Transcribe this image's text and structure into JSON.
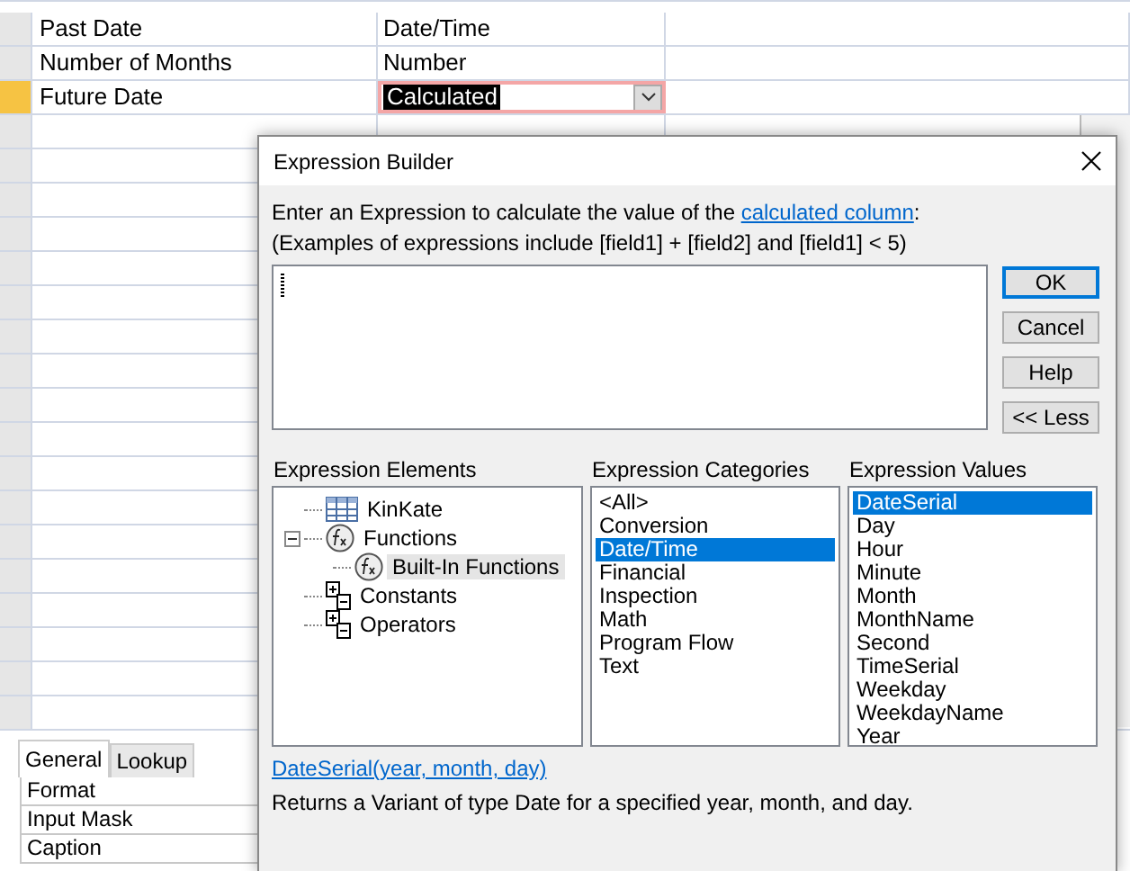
{
  "table": {
    "rows": [
      {
        "field_name": "Past Date",
        "data_type": "Date/Time",
        "selected": false
      },
      {
        "field_name": "Number of Months",
        "data_type": "Number",
        "selected": false
      },
      {
        "field_name": "Future Date",
        "data_type": "Calculated",
        "selected": true
      }
    ]
  },
  "field_properties": {
    "tabs": [
      {
        "label": "General",
        "selected": true
      },
      {
        "label": "Lookup",
        "selected": false
      }
    ],
    "rows": [
      "Format",
      "Input Mask",
      "Caption"
    ]
  },
  "dialog": {
    "title": "Expression Builder",
    "prompt": {
      "text": "Enter an Expression to calculate the value of the",
      "link": "calculated column",
      "suffix": ":"
    },
    "examples": "(Examples of expressions include [field1] + [field2] and [field1] < 5)",
    "buttons": [
      {
        "label": "OK",
        "default": true
      },
      {
        "label": "Cancel",
        "default": false
      },
      {
        "label": "Help",
        "default": false
      },
      {
        "label": "<< Less",
        "default": false
      }
    ],
    "elements": {
      "label": "Expression Elements",
      "tree": [
        {
          "label": "KinKate",
          "kind": "table",
          "selected": false
        },
        {
          "label": "Functions",
          "kind": "function",
          "selected": false,
          "expanded": true,
          "children": [
            {
              "label": "Built-In Functions",
              "kind": "function",
              "selected": true
            }
          ]
        },
        {
          "label": "Constants",
          "kind": "group",
          "selected": false
        },
        {
          "label": "Operators",
          "kind": "group",
          "selected": false
        }
      ]
    },
    "categories": {
      "label": "Expression Categories",
      "items": [
        {
          "label": "<All>",
          "selected": false
        },
        {
          "label": "Conversion",
          "selected": false
        },
        {
          "label": "Date/Time",
          "selected": true
        },
        {
          "label": "Financial",
          "selected": false
        },
        {
          "label": "Inspection",
          "selected": false
        },
        {
          "label": "Math",
          "selected": false
        },
        {
          "label": "Program Flow",
          "selected": false
        },
        {
          "label": "Text",
          "selected": false
        }
      ]
    },
    "values": {
      "label": "Expression Values",
      "items": [
        {
          "label": "DateSerial",
          "selected": true
        },
        {
          "label": "Day",
          "selected": false
        },
        {
          "label": "Hour",
          "selected": false
        },
        {
          "label": "Minute",
          "selected": false
        },
        {
          "label": "Month",
          "selected": false
        },
        {
          "label": "MonthName",
          "selected": false
        },
        {
          "label": "Second",
          "selected": false
        },
        {
          "label": "TimeSerial",
          "selected": false
        },
        {
          "label": "Weekday",
          "selected": false
        },
        {
          "label": "WeekdayName",
          "selected": false
        },
        {
          "label": "Year",
          "selected": false
        }
      ]
    },
    "function_signature": "DateSerial(year, month, day)",
    "description": "Returns a Variant of type Date for a specified year, month, and day."
  }
}
